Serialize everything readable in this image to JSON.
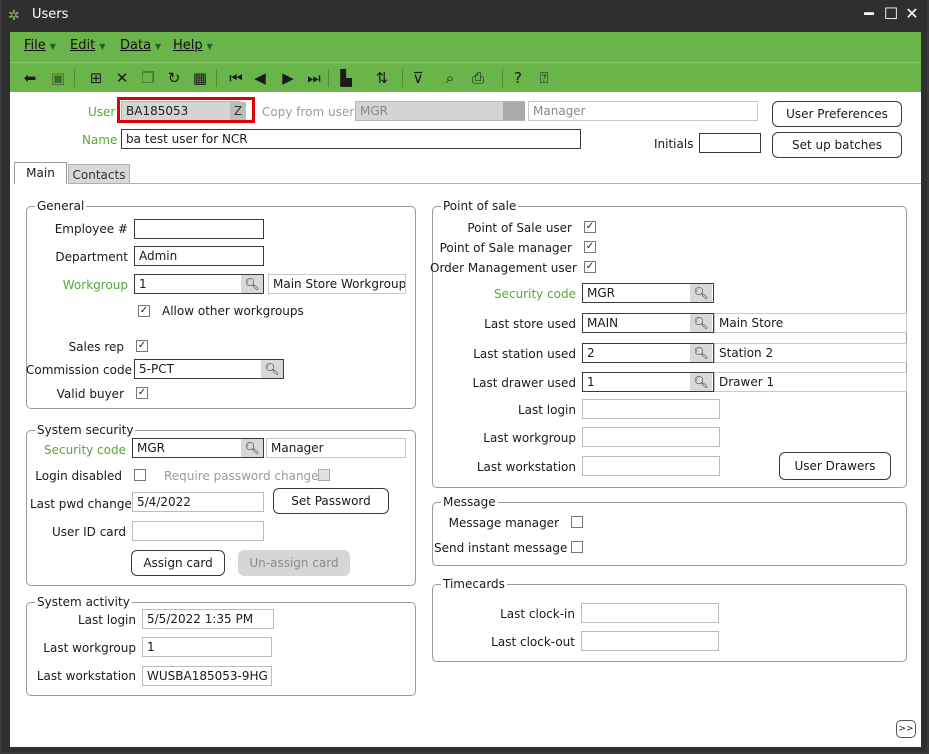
{
  "window": {
    "title": "Users"
  },
  "menu": [
    {
      "label": "File"
    },
    {
      "label": "Edit"
    },
    {
      "label": "Data"
    },
    {
      "label": "Help"
    }
  ],
  "header": {
    "user_label": "User",
    "user_value": "BA185053",
    "copy_from_label": "Copy from user",
    "copy_from_value": "MGR",
    "copy_from_desc": "Manager",
    "name_label": "Name",
    "name_value": "ba test user for NCR",
    "initials_label": "Initials",
    "initials_value": "",
    "user_prefs_button": "User Preferences",
    "setup_batches_button": "Set up batches"
  },
  "tabs": [
    {
      "label": "Main"
    },
    {
      "label": "Contacts"
    }
  ],
  "general": {
    "title": "General",
    "employee_label": "Employee #",
    "employee_value": "",
    "department_label": "Department",
    "department_value": "Admin",
    "workgroup_label": "Workgroup",
    "workgroup_value": "1",
    "workgroup_desc": "Main Store Workgroup",
    "allow_other_label": "Allow other workgroups",
    "sales_rep_label": "Sales rep",
    "commission_label": "Commission code",
    "commission_value": "5-PCT",
    "valid_buyer_label": "Valid buyer"
  },
  "system_security": {
    "title": "System security",
    "security_code_label": "Security code",
    "security_code_value": "MGR",
    "security_code_desc": "Manager",
    "login_disabled_label": "Login disabled",
    "require_pwd_label": "Require password change",
    "last_pwd_label": "Last pwd change",
    "last_pwd_value": "5/4/2022",
    "set_password_button": "Set Password",
    "user_id_card_label": "User ID card",
    "user_id_card_value": "",
    "assign_card_button": "Assign card",
    "unassign_card_button": "Un-assign card"
  },
  "system_activity": {
    "title": "System activity",
    "last_login_label": "Last login",
    "last_login_value": "5/5/2022 1:35 PM",
    "last_workgroup_label": "Last workgroup",
    "last_workgroup_value": "1",
    "last_workstation_label": "Last workstation",
    "last_workstation_value": "WUSBA185053-9HG"
  },
  "pos": {
    "title": "Point of sale",
    "pos_user_label": "Point of Sale user",
    "pos_manager_label": "Point of Sale manager",
    "order_mgmt_label": "Order Management user",
    "security_code_label": "Security code",
    "security_code_value": "MGR",
    "last_store_label": "Last store used",
    "last_store_value": "MAIN",
    "last_store_desc": "Main Store",
    "last_station_label": "Last station used",
    "last_station_value": "2",
    "last_station_desc": "Station 2",
    "last_drawer_label": "Last drawer used",
    "last_drawer_value": "1",
    "last_drawer_desc": "Drawer 1",
    "last_login_label": "Last login",
    "last_login_value": "",
    "last_workgroup_label": "Last workgroup",
    "last_workgroup_value": "",
    "last_workstation_label": "Last workstation",
    "last_workstation_value": "",
    "user_drawers_button": "User Drawers"
  },
  "message": {
    "title": "Message",
    "manager_label": "Message manager",
    "instant_label": "Send instant message"
  },
  "timecards": {
    "title": "Timecards",
    "clockin_label": "Last clock-in",
    "clockin_value": "",
    "clockout_label": "Last clock-out",
    "clockout_value": ""
  },
  "footer": {
    "more_button": ">>"
  },
  "colors": {
    "accent": "#6ab54a",
    "highlight": "#e00000"
  }
}
